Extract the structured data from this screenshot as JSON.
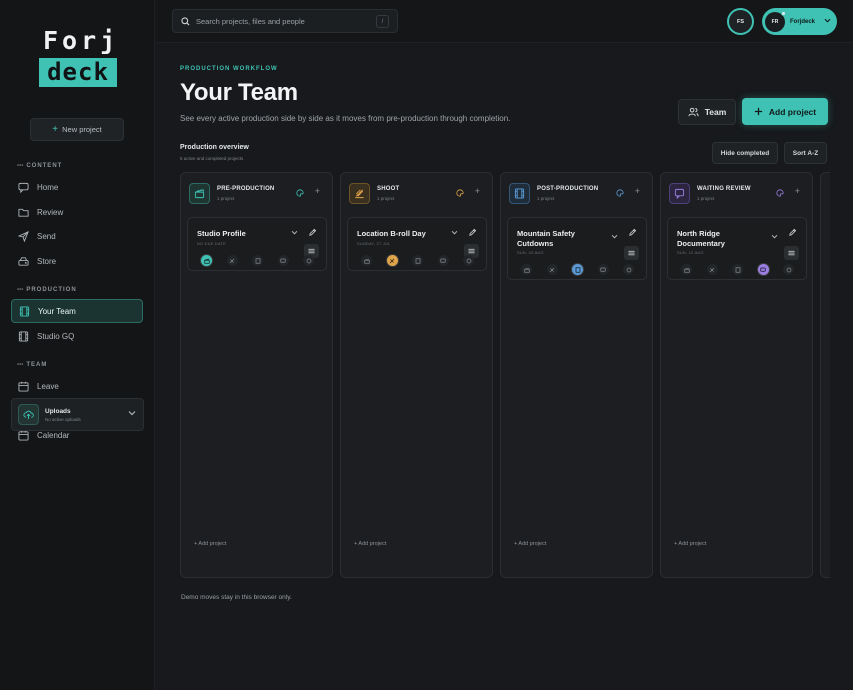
{
  "brand": {
    "logo_top": "Forj",
    "logo_bottom": "deck"
  },
  "sidebar": {
    "new_project_label": "New project",
    "sections": {
      "content": "CONTENT",
      "production": "PRODUCTION",
      "team": "TEAM"
    },
    "items": {
      "home": "Home",
      "review": "Review",
      "send": "Send",
      "store": "Store",
      "your_team": "Your Team",
      "studio_gq": "Studio GQ",
      "leave": "Leave",
      "calendar": "Calendar"
    },
    "uploads": {
      "title": "Uploads",
      "subtitle": "No active uploads"
    }
  },
  "topbar": {
    "search_placeholder": "Search projects, files and people",
    "search_shortcut": "/",
    "presence_initials": "FS",
    "user_initials": "FR",
    "user_name": "Forjdeck"
  },
  "header": {
    "eyebrow": "PRODUCTION WORKFLOW",
    "title": "Your Team",
    "description": "See every active production side by side as it moves from pre-production through completion.",
    "team_button": "Team",
    "add_project_button": "Add project"
  },
  "overview": {
    "title": "Production overview",
    "subtitle": "5 active and completed projects",
    "hide_completed": "Hide completed",
    "sort": "Sort A-Z"
  },
  "columns": [
    {
      "title": "PRE-PRODUCTION",
      "count": "1 project",
      "color": "#3fc1b3",
      "icon": "clapper-icon",
      "add_label": "+ Add project",
      "card": {
        "title": "Studio Profile",
        "meta": "NO DUE DATE",
        "active_stage": 0
      }
    },
    {
      "title": "SHOOT",
      "count": "1 project",
      "color": "#e0a44a",
      "icon": "camera-icon",
      "add_label": "+ Add project",
      "card": {
        "title": "Location B-roll Day",
        "meta": "SUNDAY, 27 JUL",
        "active_stage": 1
      }
    },
    {
      "title": "POST-PRODUCTION",
      "count": "1 project",
      "color": "#5b9bd5",
      "icon": "film-icon",
      "add_label": "+ Add project",
      "card": {
        "title": "Mountain Safety Cutdowns",
        "meta": "SUN, 03 AUG",
        "active_stage": 2
      }
    },
    {
      "title": "WAITING REVIEW",
      "count": "1 project",
      "color": "#9b7fe0",
      "icon": "chat-icon",
      "add_label": "+ Add project",
      "card": {
        "title": "North Ridge Documentary",
        "meta": "SUN, 10 AUG",
        "active_stage": 3
      }
    }
  ],
  "footnote": "Demo moves stay in this browser only."
}
